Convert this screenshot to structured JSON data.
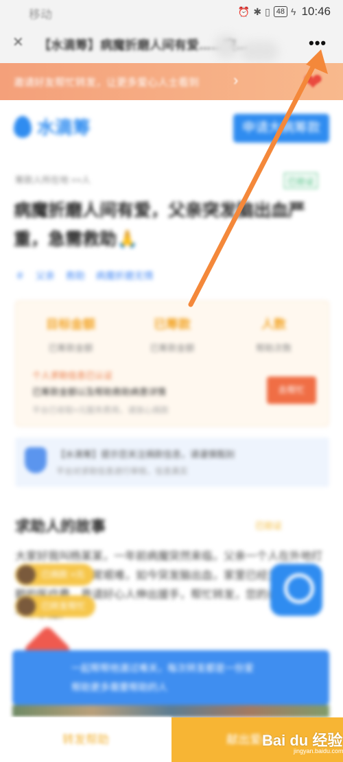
{
  "status_bar": {
    "carrier": "移动",
    "battery": "48",
    "time": "10:46"
  },
  "title_bar": {
    "back_label": "✕",
    "title": "【水滴筹】病魔折磨人间有爱……突…",
    "more_label": "•••"
  },
  "banner": {
    "text": "邀请好友帮忙转发，让更多爱心人士看到",
    "arrow": "›"
  },
  "brand": {
    "name": "水滴筹",
    "apply_button": "申请大病筹款"
  },
  "story": {
    "source": "筹款人所在地 ××人",
    "verify_badge": "已验证",
    "headline": "病魔折磨人间有爱，父亲突发脑出血严重，急需救助🙏",
    "tags": [
      "＃",
      "父亲",
      "救助",
      "病魔折磨无情"
    ],
    "funds": {
      "stats": [
        {
          "value": "目标金额",
          "label": "已筹款金额"
        },
        {
          "value": "已筹款",
          "label": "已筹款金额"
        },
        {
          "value": "人数",
          "label": "帮助次数"
        }
      ],
      "hint": "个人求助信息已认证",
      "line": "已筹款金额以及帮助救助病患详情",
      "line2": "平台已收取×元服务费用，请放心捐款",
      "button": "去帮忙"
    },
    "notice": {
      "line1": "【水滴筹】提示您关注捐款信息，请谨慎甄别",
      "line2": "平台对求助信息进行审核，信息真实"
    },
    "section_title": "求助人的故事",
    "section_verify": "已验证",
    "body": "大家好我叫杨某某，一年前病魔突然来临，父亲一个人在外地打工养家，生活非常艰难，如今突发脑出血，家里已经无法承担高额的医疗费，恳请好心人伸出援手，帮忙转发，您的善举将拯救一个家庭。",
    "chips": [
      "已捐款 ×元",
      "已转发帮忙"
    ],
    "help_card": {
      "line1": "一起帮帮他渡过难关，每次转发都是一份爱",
      "line2": "帮助更多需要帮助的人"
    }
  },
  "footer": {
    "left_label": "转发帮助",
    "right_label": "献出爱心"
  },
  "watermark": {
    "brand": "Bai du 经验",
    "domain": "jingyan.baidu.com"
  },
  "colors": {
    "arrow": "#f4883a",
    "brand_blue": "#2f8cf0",
    "footer_orange": "#f7b534"
  }
}
